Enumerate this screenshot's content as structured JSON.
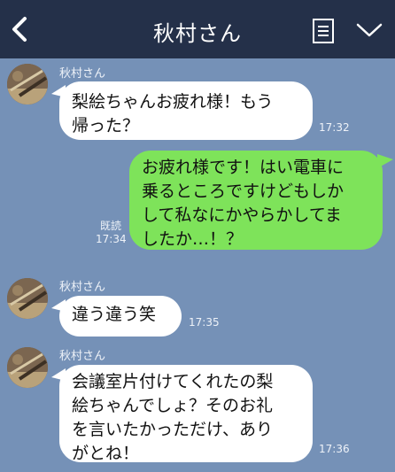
{
  "header": {
    "title": "秋村さん"
  },
  "messages": [
    {
      "sender": "秋村さん",
      "lines": [
        "梨絵ちゃんお疲れ様！もう",
        "帰った？"
      ],
      "time": "17:32"
    },
    {
      "lines": [
        "お疲れ様です！はい電車に",
        "乗るところですけどもしか",
        "して私なにかやらかしてま",
        "したか…！？"
      ],
      "read": "既読",
      "time": "17:34"
    },
    {
      "sender": "秋村さん",
      "lines": [
        "違う違う笑"
      ],
      "time": "17:35"
    },
    {
      "sender": "秋村さん",
      "lines": [
        "会議室片付けてくれたの梨",
        "絵ちゃんでしょ？そのお礼",
        "を言いたかっただけ、あり",
        "がとね！"
      ],
      "time": "17:36"
    }
  ],
  "colors": {
    "header": "#243049",
    "background": "#7591b7",
    "incoming_bubble": "#ffffff",
    "outgoing_bubble": "#7ee35a"
  }
}
